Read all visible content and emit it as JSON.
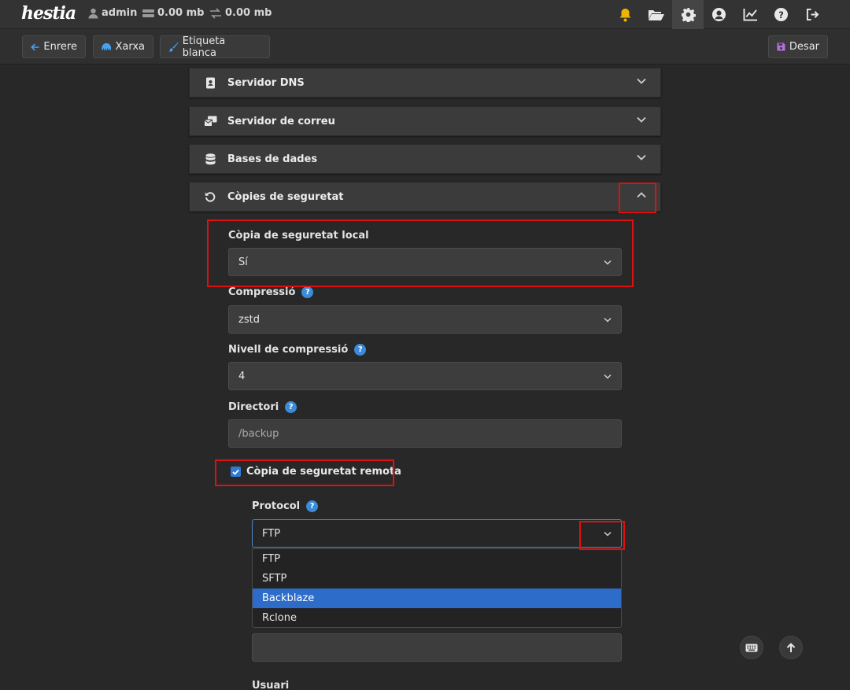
{
  "topbar": {
    "logo": "hestia",
    "user": "admin",
    "disk": "0.00 mb",
    "bandwidth": "0.00 mb"
  },
  "toolbar": {
    "back_label": "Enrere",
    "network_label": "Xarxa",
    "whitelabel_label": "Etiqueta blanca",
    "save_label": "Desar"
  },
  "sections": [
    {
      "label": "Servidor DNS"
    },
    {
      "label": "Servidor de correu"
    },
    {
      "label": "Bases de dades"
    },
    {
      "label": "Còpies de seguretat"
    }
  ],
  "backup": {
    "local_label": "Còpia de seguretat local",
    "local_value": "Sí",
    "compression_label": "Compressió",
    "compression_value": "zstd",
    "level_label": "Nivell de compressió",
    "level_value": "4",
    "directory_label": "Directori",
    "directory_value": "/backup",
    "remote_label": "Còpia de seguretat remota",
    "remote_checked": true,
    "protocol_label": "Protocol",
    "protocol_value": "FTP",
    "protocol_options": [
      "FTP",
      "SFTP",
      "Backblaze",
      "Rclone"
    ],
    "protocol_highlighted": "Backblaze",
    "user_label": "Usuari"
  },
  "colors": {
    "accent": "#2d6cc8",
    "highlight_box": "#e01010",
    "bell": "#f0b400",
    "folder": "#e8e8e8",
    "save_icon": "#b36ee0"
  }
}
